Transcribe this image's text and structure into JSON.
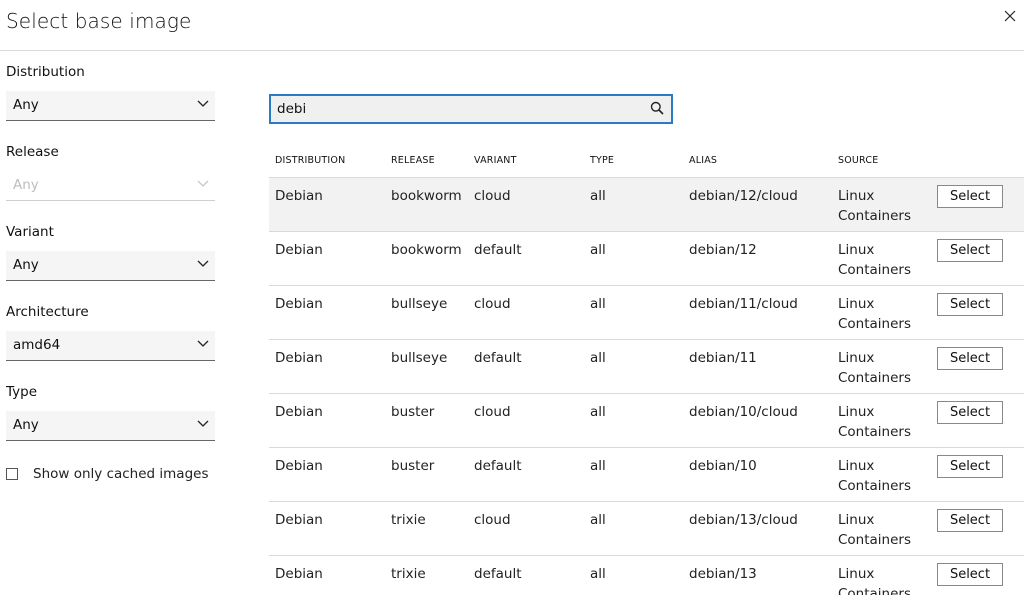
{
  "modal": {
    "title": "Select base image"
  },
  "filters": {
    "distribution": {
      "label": "Distribution",
      "value": "Any"
    },
    "release": {
      "label": "Release",
      "value": "Any"
    },
    "variant": {
      "label": "Variant",
      "value": "Any"
    },
    "architecture": {
      "label": "Architecture",
      "value": "amd64"
    },
    "type": {
      "label": "Type",
      "value": "Any"
    },
    "cached_label": "Show only cached images"
  },
  "search": {
    "value": "debi"
  },
  "table": {
    "headers": {
      "distribution": "DISTRIBUTION",
      "release": "RELEASE",
      "variant": "VARIANT",
      "type": "TYPE",
      "alias": "ALIAS",
      "source": "SOURCE"
    },
    "select_label": "Select",
    "rows": [
      {
        "distribution": "Debian",
        "release": "bookworm",
        "variant": "cloud",
        "type": "all",
        "alias": "debian/12/cloud",
        "source": "Linux Containers"
      },
      {
        "distribution": "Debian",
        "release": "bookworm",
        "variant": "default",
        "type": "all",
        "alias": "debian/12",
        "source": "Linux Containers"
      },
      {
        "distribution": "Debian",
        "release": "bullseye",
        "variant": "cloud",
        "type": "all",
        "alias": "debian/11/cloud",
        "source": "Linux Containers"
      },
      {
        "distribution": "Debian",
        "release": "bullseye",
        "variant": "default",
        "type": "all",
        "alias": "debian/11",
        "source": "Linux Containers"
      },
      {
        "distribution": "Debian",
        "release": "buster",
        "variant": "cloud",
        "type": "all",
        "alias": "debian/10/cloud",
        "source": "Linux Containers"
      },
      {
        "distribution": "Debian",
        "release": "buster",
        "variant": "default",
        "type": "all",
        "alias": "debian/10",
        "source": "Linux Containers"
      },
      {
        "distribution": "Debian",
        "release": "trixie",
        "variant": "cloud",
        "type": "all",
        "alias": "debian/13/cloud",
        "source": "Linux Containers"
      },
      {
        "distribution": "Debian",
        "release": "trixie",
        "variant": "default",
        "type": "all",
        "alias": "debian/13",
        "source": "Linux Containers"
      }
    ]
  },
  "colors": {
    "accent": "#2b7ac4",
    "row_highlight": "#f2f2f2",
    "divider": "#d9d9d9"
  },
  "icons": {
    "close": "close-icon",
    "chevron": "chevron-down-icon",
    "search": "search-icon"
  }
}
